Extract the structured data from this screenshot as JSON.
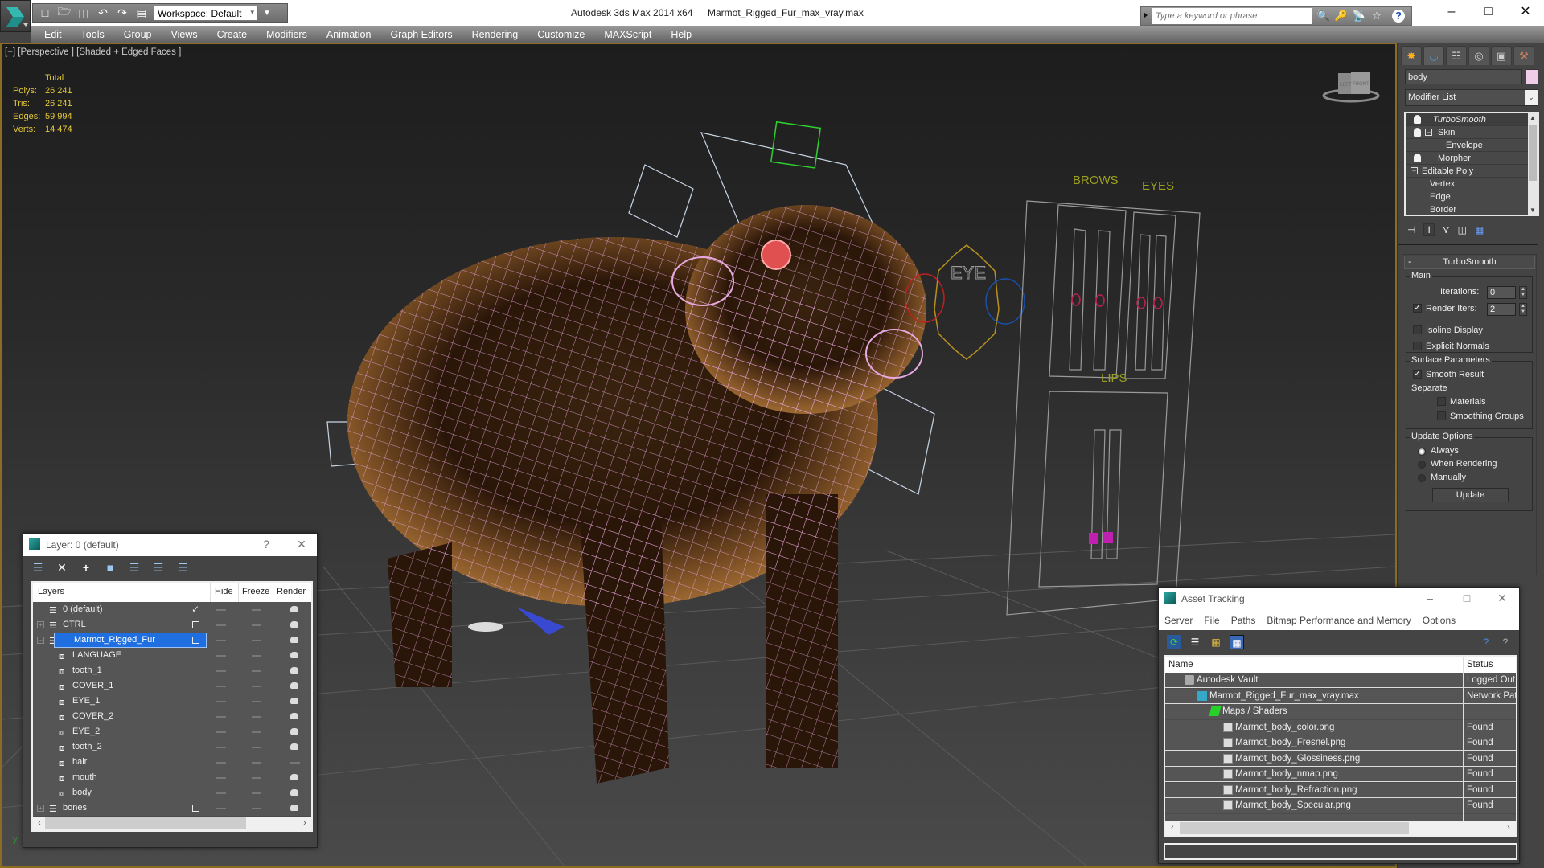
{
  "titlebar": {
    "app_title": "Autodesk 3ds Max  2014 x64",
    "file_name": "Marmot_Rigged_Fur_max_vray.max",
    "workspace": "Workspace: Default",
    "search_placeholder": "Type a keyword or phrase",
    "icons": [
      "new-file-icon",
      "open-file-icon",
      "save-icon",
      "undo-icon",
      "redo-icon",
      "project-folder-icon"
    ],
    "search_icons": [
      "binoculars-icon",
      "key-icon",
      "satellite-icon",
      "star-icon",
      "help-icon"
    ]
  },
  "menu": [
    "Edit",
    "Tools",
    "Group",
    "Views",
    "Create",
    "Modifiers",
    "Animation",
    "Graph Editors",
    "Rendering",
    "Customize",
    "MAXScript",
    "Help"
  ],
  "viewport": {
    "label": "[+] [Perspective ] [Shaded + Edged Faces ]",
    "stats": {
      "header": "Total",
      "rows": [
        {
          "key": "Polys:",
          "value": "26 241"
        },
        {
          "key": "Tris:",
          "value": "26 241"
        },
        {
          "key": "Edges:",
          "value": "59 994"
        },
        {
          "key": "Verts:",
          "value": "14 474"
        }
      ]
    },
    "viewcube": {
      "left": "LEFT",
      "front": "FRONT"
    },
    "rig_labels": {
      "eye": "EYE",
      "brows": "BROWS",
      "eyes": "EYES",
      "lips": "LIPS"
    },
    "axis_label": "y"
  },
  "command_panel": {
    "tabs": [
      "create-tab",
      "modify-tab",
      "hierarchy-tab",
      "motion-tab",
      "display-tab",
      "utilities-tab"
    ],
    "object_name": "body",
    "object_color": "#efcde8",
    "modifier_list_label": "Modifier List",
    "stack": [
      {
        "label": "TurboSmooth",
        "italic": true,
        "bulb": true,
        "selected": true
      },
      {
        "label": "Skin",
        "bulb": true,
        "expander": true
      },
      {
        "label": "Envelope",
        "sub": true
      },
      {
        "label": "Morpher",
        "bulb": true
      },
      {
        "label": "Editable Poly",
        "expander": true
      },
      {
        "label": "Vertex",
        "sub": true
      },
      {
        "label": "Edge",
        "sub": true
      },
      {
        "label": "Border",
        "sub": true
      }
    ],
    "rollout": {
      "title": "TurboSmooth",
      "main_group": "Main",
      "iterations_label": "Iterations:",
      "iterations_value": "0",
      "render_iters_label": "Render Iters:",
      "render_iters_value": "2",
      "render_iters_checked": true,
      "isoline_label": "Isoline Display",
      "isoline_checked": false,
      "explicit_normals_label": "Explicit Normals",
      "explicit_normals_checked": false,
      "surface_group": "Surface Parameters",
      "smooth_result_label": "Smooth Result",
      "smooth_result_checked": true,
      "separate_label": "Separate",
      "materials_label": "Materials",
      "smoothing_groups_label": "Smoothing Groups",
      "update_group": "Update Options",
      "update_options": [
        "Always",
        "When Rendering",
        "Manually"
      ],
      "update_selected": "Always",
      "update_button": "Update"
    }
  },
  "layer_dialog": {
    "title": "Layer: 0 (default)",
    "help": "?",
    "close": "✕",
    "columns": [
      "Layers",
      "Hide",
      "Freeze",
      "Render"
    ],
    "rows": [
      {
        "name": "0 (default)",
        "type": "layer",
        "level": 0,
        "active": "check",
        "render": true
      },
      {
        "name": "CTRL",
        "type": "layer",
        "level": 0,
        "expander": "+",
        "active": "box",
        "render": true
      },
      {
        "name": "Marmot_Rigged_Fur",
        "type": "layer",
        "level": 0,
        "expander": "-",
        "active": "box",
        "selected": true,
        "render": true
      },
      {
        "name": "LANGUAGE",
        "type": "object",
        "level": 1,
        "render": true
      },
      {
        "name": "tooth_1",
        "type": "object",
        "level": 1,
        "render": true
      },
      {
        "name": "COVER_1",
        "type": "object",
        "level": 1,
        "render": true
      },
      {
        "name": "EYE_1",
        "type": "object",
        "level": 1,
        "render": true
      },
      {
        "name": "COVER_2",
        "type": "object",
        "level": 1,
        "render": true
      },
      {
        "name": "EYE_2",
        "type": "object",
        "level": 1,
        "render": true
      },
      {
        "name": "tooth_2",
        "type": "object",
        "level": 1,
        "render": true
      },
      {
        "name": "hair",
        "type": "object",
        "level": 1,
        "render": false
      },
      {
        "name": "mouth",
        "type": "object",
        "level": 1,
        "render": true
      },
      {
        "name": "body",
        "type": "object",
        "level": 1,
        "render": true
      },
      {
        "name": "bones",
        "type": "layer",
        "level": 0,
        "expander": "+",
        "active": "box",
        "render": true
      }
    ]
  },
  "asset_dialog": {
    "title": "Asset Tracking",
    "menu": [
      "Server",
      "File",
      "Paths",
      "Bitmap Performance and Memory",
      "Options"
    ],
    "columns": [
      "Name",
      "Status"
    ],
    "rows": [
      {
        "name": "Autodesk Vault",
        "status": "Logged Out",
        "level": 0,
        "icon": "vault-icon"
      },
      {
        "name": "Marmot_Rigged_Fur_max_vray.max",
        "status": "Network Pat",
        "level": 1,
        "icon": "max-file-icon"
      },
      {
        "name": "Maps / Shaders",
        "status": "",
        "level": 2,
        "icon": "maps-icon"
      },
      {
        "name": "Marmot_body_color.png",
        "status": "Found",
        "level": 3,
        "icon": "bitmap-icon"
      },
      {
        "name": "Marmot_body_Fresnel.png",
        "status": "Found",
        "level": 3,
        "icon": "bitmap-icon"
      },
      {
        "name": "Marmot_body_Glossiness.png",
        "status": "Found",
        "level": 3,
        "icon": "bitmap-icon"
      },
      {
        "name": "Marmot_body_nmap.png",
        "status": "Found",
        "level": 3,
        "icon": "bitmap-icon"
      },
      {
        "name": "Marmot_body_Refraction.png",
        "status": "Found",
        "level": 3,
        "icon": "bitmap-icon"
      },
      {
        "name": "Marmot_body_Specular.png",
        "status": "Found",
        "level": 3,
        "icon": "bitmap-icon"
      }
    ]
  },
  "colors": {
    "viewport_border": "#8a6d22",
    "stats_text": "#e4c93a",
    "selection_blue": "#1f6fe0",
    "rig_label_olive": "#9aa020",
    "eye_ctrl_gold": "#b89020",
    "eye_ctrl_red": "#c02020",
    "eye_ctrl_blue": "#1a4fa8",
    "lips_magenta": "#c020b0"
  }
}
